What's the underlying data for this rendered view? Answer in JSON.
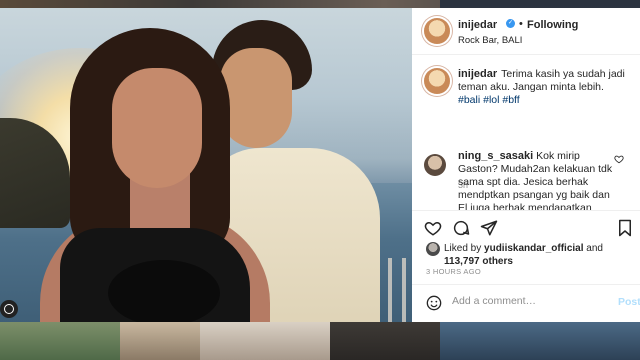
{
  "post": {
    "username": "inijedar",
    "follow_label": "Following",
    "location": "Rock Bar, BALI",
    "caption_text": "Terima kasih ya sudah jadi teman aku. Jangan minta lebih.",
    "caption_tags": "#bali #lol #bff",
    "caption_time": "3h"
  },
  "comment": {
    "username": "ning_s_sasaki",
    "text": "Kok mirip Gaston? Mudah2an kelakuan tdk sama spt dia. Jesica berhak mendptkan psangan yg baik dan El juga berhak mendapatkan yang"
  },
  "likes": {
    "prefix": "Liked by",
    "user": "yudiiskandar_official",
    "and": "and",
    "count": "113,797 others"
  },
  "post_time": "3 HOURS AGO",
  "add_comment": {
    "placeholder": "Add a comment…",
    "post_label": "Post"
  },
  "colors": {
    "link": "#00376b",
    "verified": "#3897f0",
    "muted": "#8e8e8e"
  }
}
